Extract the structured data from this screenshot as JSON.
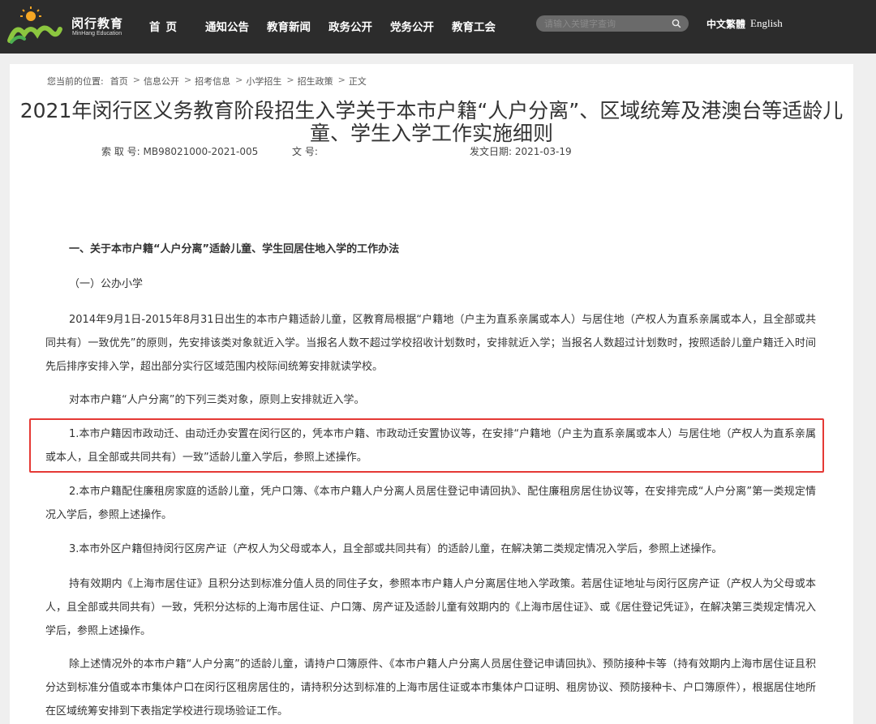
{
  "header": {
    "logo_cn": "闵行教育",
    "logo_en": "MinHang Education",
    "nav": [
      "首页",
      "通知公告",
      "教育新闻",
      "政务公开",
      "党务公开",
      "教育工会"
    ],
    "search_placeholder": "请输入关键字查询",
    "lang_cn": "中文繁體",
    "lang_en": "English"
  },
  "breadcrumb": {
    "prefix": "您当前的位置:",
    "items": [
      "首页",
      "信息公开",
      "招考信息",
      "小学招生",
      "招生政策",
      "正文"
    ]
  },
  "article": {
    "title": "2021年闵行区义务教育阶段招生入学关于本市户籍“人户分离”、区域统筹及港澳台等适龄儿童、学生入学工作实施细则",
    "meta": {
      "index_no": "索 取 号:  MB98021000-2021-005",
      "doc_no": "文       号:",
      "date": "发文日期:  2021-03-19"
    },
    "paragraphs": [
      "一、关于本市户籍“人户分离”适龄儿童、学生回居住地入学的工作办法",
      "（一）公办小学",
      "2014年9月1日-2015年8月31日出生的本市户籍适龄儿童，区教育局根据“户籍地（户主为直系亲属或本人）与居住地（产权人为直系亲属或本人，且全部或共同共有）一致优先”的原则，先安排该类对象就近入学。当报名人数不超过学校招收计划数时，安排就近入学；当报名人数超过计划数时，按照适龄儿童户籍迁入时间先后排序安排入学，超出部分实行区域范围内校际间统筹安排就读学校。",
      "对本市户籍“人户分离”的下列三类对象，原则上安排就近入学。",
      "1.本市户籍因市政动迁、由动迁办安置在闵行区的，凭本市户籍、市政动迁安置协议等，在安排“户籍地（户主为直系亲属或本人）与居住地（产权人为直系亲属或本人，且全部或共同共有）一致”适龄儿童入学后，参照上述操作。",
      "2.本市户籍配住廉租房家庭的适龄儿童，凭户口簿、《本市户籍人户分离人员居住登记申请回执》、配住廉租房居住协议等，在安排完成“人户分离”第一类规定情况入学后，参照上述操作。",
      "3.本市外区户籍但持闵行区房产证（产权人为父母或本人，且全部或共同共有）的适龄儿童，在解决第二类规定情况入学后，参照上述操作。",
      "持有效期内《上海市居住证》且积分达到标准分值人员的同住子女，参照本市户籍人户分离居住地入学政策。若居住证地址与闵行区房产证（产权人为父母或本人，且全部或共同共有）一致，凭积分达标的上海市居住证、户口簿、房产证及适龄儿童有效期内的《上海市居住证》、或《居住登记凭证》，在解决第三类规定情况入学后，参照上述操作。",
      "除上述情况外的本市户籍“人户分离”的适龄儿童，请持户口簿原件、《本市户籍人户分离人员居住登记申请回执》、预防接种卡等（持有效期内上海市居住证且积分达到标准分值或本市集体户口在闵行区租房居住的，请持积分达到标准的上海市居住证或本市集体户口证明、租房协议、预防接种卡、户口簿原件），根据居住地所在区域统筹安排到下表指定学校进行现场验证工作。"
    ]
  },
  "colors": {
    "header_bg": "#2c2c2c",
    "highlight_border": "#e53935"
  }
}
